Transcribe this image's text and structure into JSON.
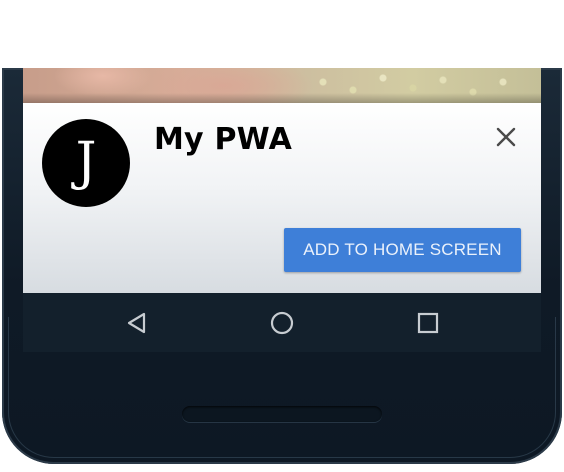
{
  "banner": {
    "app_icon_letter": "J",
    "app_name": "My PWA",
    "add_button_label": "ADD TO HOME SCREEN"
  },
  "icons": {
    "close": "close-icon",
    "back": "nav-back-icon",
    "home": "nav-home-icon",
    "recents": "nav-recents-icon"
  },
  "colors": {
    "accent": "#3e7fd8",
    "navbar": "#13202c",
    "phone_body": "#1b2a38"
  }
}
